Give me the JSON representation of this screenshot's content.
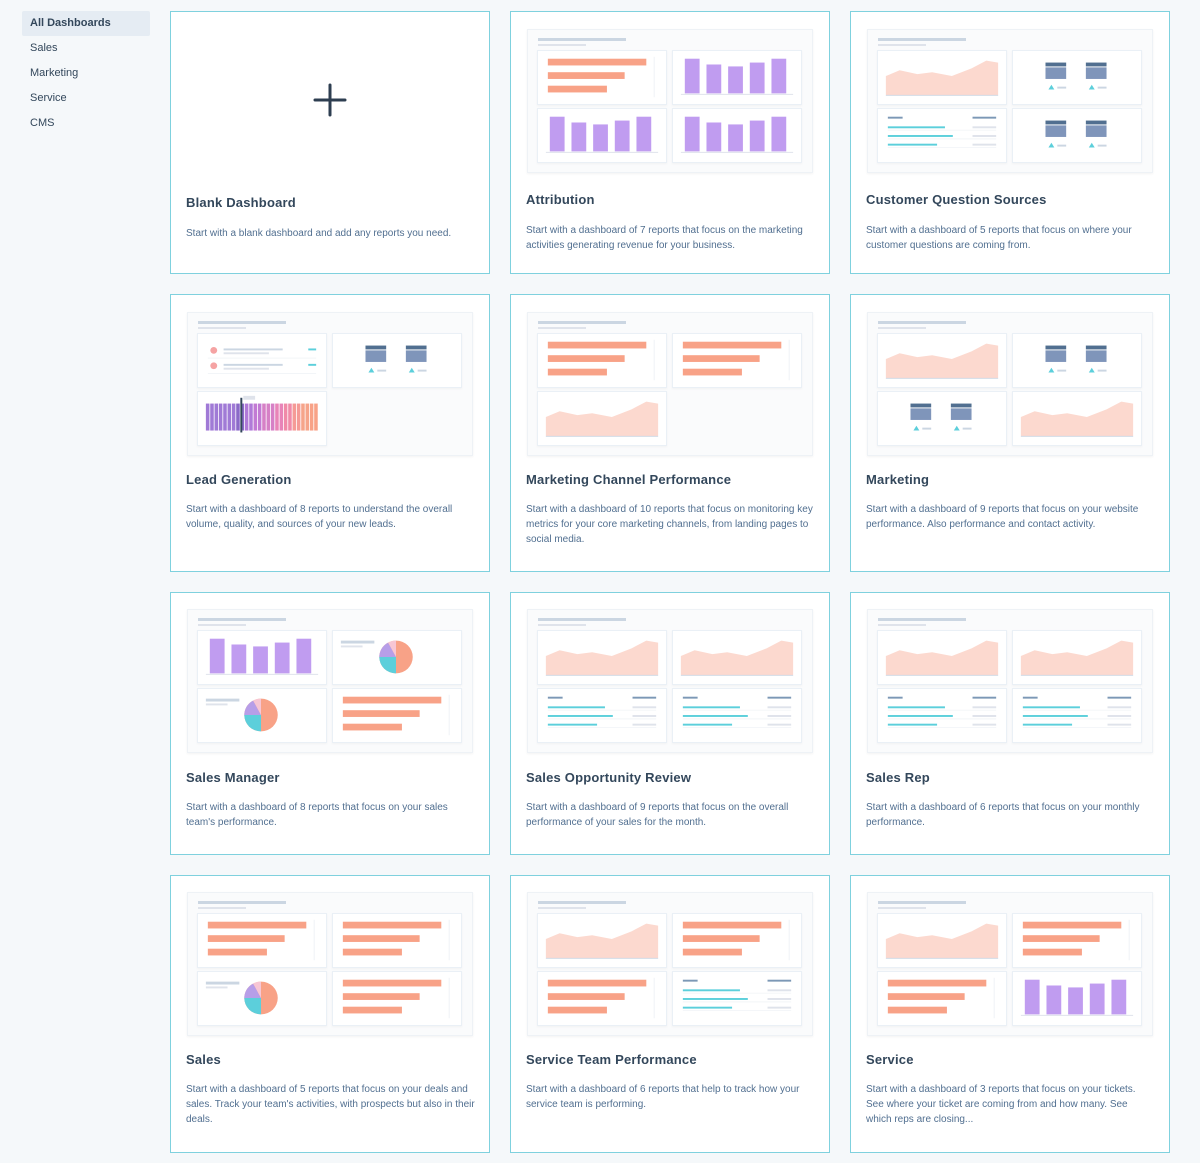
{
  "sidebar": {
    "items": [
      {
        "label": "All Dashboards",
        "active": true
      },
      {
        "label": "Sales",
        "active": false
      },
      {
        "label": "Marketing",
        "active": false
      },
      {
        "label": "Service",
        "active": false
      },
      {
        "label": "CMS",
        "active": false
      }
    ]
  },
  "colors": {
    "accent_border": "#7fd1de",
    "bar_orange": "#f8a287",
    "bar_purple": "#c09cf0",
    "area_pink": "#fcd9cf",
    "line_teal": "#5ccfdb",
    "tile_navy": "#7f95ba",
    "text_dark": "#33475b"
  },
  "cards": [
    {
      "title": "Blank Dashboard",
      "description": "Start with a blank dashboard and add any reports you need.",
      "icon": "plus-icon",
      "preview": []
    },
    {
      "title": "Attribution",
      "description": "Start with a dashboard of 7 reports that focus on the marketing activities generating revenue for your business.",
      "preview": [
        "hbar",
        "vbar",
        "vbar",
        "vbar"
      ]
    },
    {
      "title": "Customer Question Sources",
      "description": "Start with a dashboard of 5 reports that focus on where your customer questions are coming from.",
      "preview": [
        "area",
        "kpi",
        "table",
        "kpi"
      ]
    },
    {
      "title": "Lead Generation",
      "description": "Start with a dashboard of 8 reports to understand the overall volume, quality, and sources of your new leads.",
      "preview": [
        "list",
        "kpi",
        "stripes"
      ]
    },
    {
      "title": "Marketing Channel Performance",
      "description": "Start with a dashboard of 10 reports that focus on monitoring key metrics for your core marketing channels, from landing pages to social media.",
      "preview": [
        "hbar",
        "hbar",
        "area"
      ]
    },
    {
      "title": "Marketing",
      "description": "Start with a dashboard of 9 reports that focus on your website performance. Also performance and contact activity.",
      "preview": [
        "area",
        "kpi",
        "kpi",
        "area"
      ]
    },
    {
      "title": "Sales Manager",
      "description": "Start with a dashboard of 8 reports that focus on your sales team's performance.",
      "preview": [
        "vbar",
        "pie",
        "pie",
        "hbar"
      ]
    },
    {
      "title": "Sales Opportunity Review",
      "description": "Start with a dashboard of 9 reports that focus on the overall performance of your sales for the month.",
      "preview": [
        "area",
        "area",
        "table",
        "table"
      ]
    },
    {
      "title": "Sales Rep",
      "description": "Start with a dashboard of 6 reports that focus on your monthly performance.",
      "preview": [
        "area",
        "area",
        "table",
        "table"
      ]
    },
    {
      "title": "Sales",
      "description": "Start with a dashboard of 5 reports that focus on your deals and sales. Track your team's activities, with prospects but also in their deals.",
      "preview": [
        "hbar",
        "hbar",
        "pie",
        "hbar"
      ]
    },
    {
      "title": "Service Team Performance",
      "description": "Start with a dashboard of 6 reports that help to track how your service team is performing.",
      "preview": [
        "area",
        "hbar",
        "hbar",
        "table"
      ]
    },
    {
      "title": "Service",
      "description": "Start with a dashboard of 3 reports that focus on your tickets. See where your ticket are coming from and how many. See which reps are closing...",
      "preview": [
        "area",
        "hbar",
        "hbar",
        "vbar"
      ]
    }
  ]
}
